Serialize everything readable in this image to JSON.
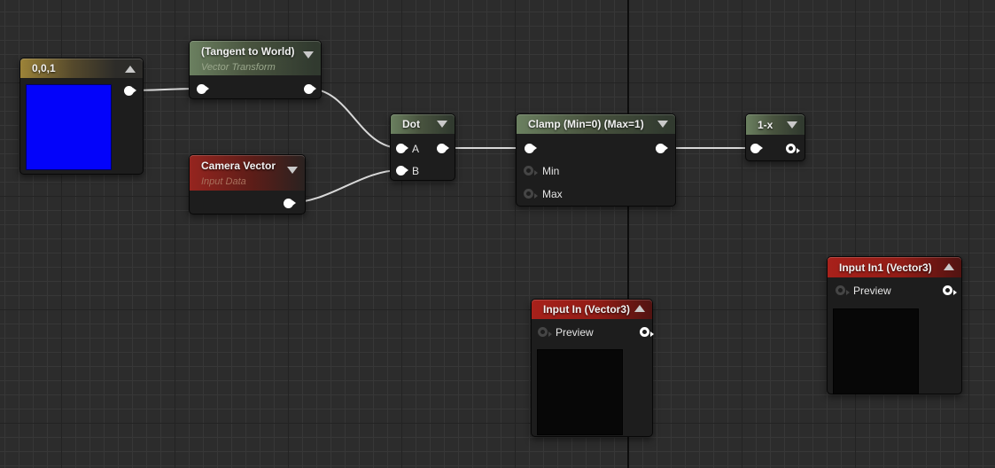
{
  "canvas": {
    "background": "#2c2c2c",
    "grid_minor_color": "#373737",
    "grid_major_color": "#232323",
    "origin_axis_color": "#0d0d0d",
    "wire_color": "#d8d8d8"
  },
  "palette": {
    "constant_header": "#9c8338",
    "math_header": "#6b8060",
    "input_data_header": "#96251f",
    "graph_input_header": "#a8211b",
    "node_body": "#1d1d1d",
    "preview_blue": "#0303fa",
    "preview_black": "#070707"
  },
  "nodes": {
    "constant": {
      "title": "0,0,1"
    },
    "vector_transform": {
      "title": "(Tangent to World)",
      "subtitle": "Vector Transform"
    },
    "camera_vector": {
      "title": "Camera Vector",
      "subtitle": "Input Data"
    },
    "dot": {
      "title": "Dot",
      "pin_a": "A",
      "pin_b": "B"
    },
    "clamp": {
      "title": "Clamp (Min=0) (Max=1)",
      "pin_min": "Min",
      "pin_max": "Max"
    },
    "one_minus_x": {
      "title": "1-x"
    },
    "input_in": {
      "title": "Input In (Vector3)",
      "pin_preview": "Preview"
    },
    "input_in1": {
      "title": "Input In1 (Vector3)",
      "pin_preview": "Preview"
    }
  }
}
